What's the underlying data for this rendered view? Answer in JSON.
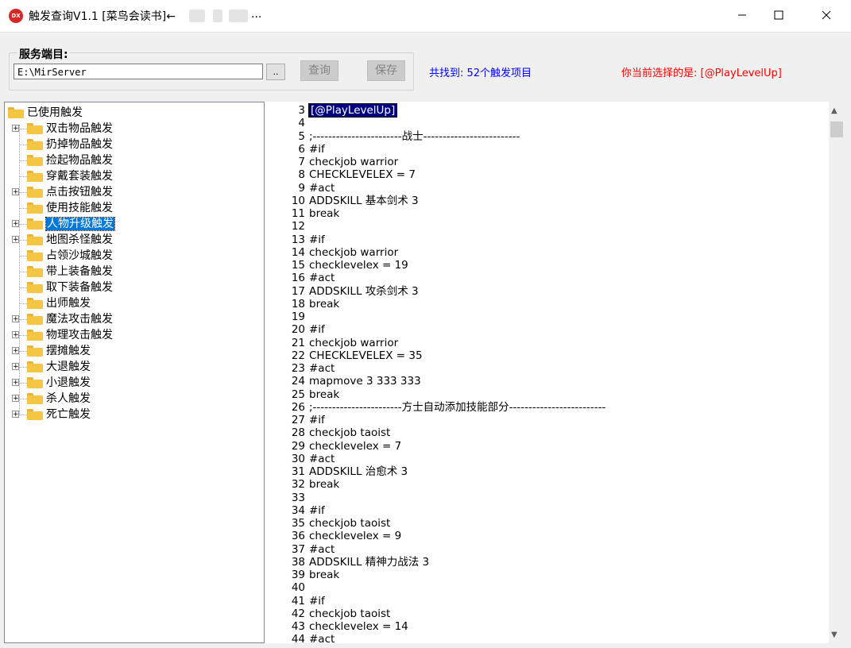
{
  "window": {
    "app_icon_text": "DX",
    "title": "触发查询V1.1 [菜鸟会读书]←",
    "title_trailing": "..."
  },
  "server": {
    "group_label": "服务端目:",
    "path_value": "E:\\MirServer",
    "browse_label": "..",
    "query_label": "查询",
    "save_label": "保存"
  },
  "status": {
    "found_text": "共找到: 52个触发项目",
    "selected_text": "你当前选择的是: [@PlayLevelUp]",
    "found_color": "#0000ff",
    "selected_color": "#ff0000"
  },
  "tree": {
    "root": "已使用触发",
    "items": [
      {
        "label": "双击物品触发",
        "expandable": true
      },
      {
        "label": "扔掉物品触发",
        "expandable": false
      },
      {
        "label": "捡起物品触发",
        "expandable": false
      },
      {
        "label": "穿戴套装触发",
        "expandable": false
      },
      {
        "label": "点击按钮触发",
        "expandable": true
      },
      {
        "label": "使用技能触发",
        "expandable": false
      },
      {
        "label": "人物升级触发",
        "expandable": true,
        "selected": true
      },
      {
        "label": "地图杀怪触发",
        "expandable": true
      },
      {
        "label": "占领沙城触发",
        "expandable": false
      },
      {
        "label": "带上装备触发",
        "expandable": false
      },
      {
        "label": "取下装备触发",
        "expandable": false
      },
      {
        "label": "出师触发",
        "expandable": false
      },
      {
        "label": "魔法攻击触发",
        "expandable": true
      },
      {
        "label": "物理攻击触发",
        "expandable": true
      },
      {
        "label": "摆摊触发",
        "expandable": true
      },
      {
        "label": "大退触发",
        "expandable": true
      },
      {
        "label": "小退触发",
        "expandable": true
      },
      {
        "label": "杀人触发",
        "expandable": true
      },
      {
        "label": "死亡触发",
        "expandable": true
      }
    ]
  },
  "editor": {
    "lines": [
      {
        "n": "3",
        "text": "[@PlayLevelUp]",
        "highlight": true
      },
      {
        "n": "4",
        "text": ""
      },
      {
        "n": "5",
        "text": ";-----------------------战士-------------------------"
      },
      {
        "n": "6",
        "text": "#if"
      },
      {
        "n": "7",
        "text": "checkjob warrior"
      },
      {
        "n": "8",
        "text": "CHECKLEVELEX = 7"
      },
      {
        "n": "9",
        "text": "#act"
      },
      {
        "n": "10",
        "text": "ADDSKILL 基本剑术 3"
      },
      {
        "n": "11",
        "text": "break"
      },
      {
        "n": "12",
        "text": ""
      },
      {
        "n": "13",
        "text": "#if"
      },
      {
        "n": "14",
        "text": "checkjob warrior"
      },
      {
        "n": "15",
        "text": "checklevelex = 19"
      },
      {
        "n": "16",
        "text": "#act"
      },
      {
        "n": "17",
        "text": "ADDSKILL 攻杀剑术 3"
      },
      {
        "n": "18",
        "text": "break"
      },
      {
        "n": "19",
        "text": ""
      },
      {
        "n": "20",
        "text": "#if"
      },
      {
        "n": "21",
        "text": "checkjob warrior"
      },
      {
        "n": "22",
        "text": "CHECKLEVELEX = 35"
      },
      {
        "n": "23",
        "text": "#act"
      },
      {
        "n": "24",
        "text": "mapmove  3  333  333"
      },
      {
        "n": "25",
        "text": "break"
      },
      {
        "n": "26",
        "text": ";-----------------------方士自动添加技能部分-------------------------"
      },
      {
        "n": "27",
        "text": "#if"
      },
      {
        "n": "28",
        "text": "checkjob taoist"
      },
      {
        "n": "29",
        "text": "checklevelex = 7"
      },
      {
        "n": "30",
        "text": "#act"
      },
      {
        "n": "31",
        "text": "ADDSKILL 治愈术 3"
      },
      {
        "n": "32",
        "text": "break"
      },
      {
        "n": "33",
        "text": ""
      },
      {
        "n": "34",
        "text": "#if"
      },
      {
        "n": "35",
        "text": "checkjob taoist"
      },
      {
        "n": "36",
        "text": "checklevelex = 9"
      },
      {
        "n": "37",
        "text": "#act"
      },
      {
        "n": "38",
        "text": "ADDSKILL 精神力战法 3"
      },
      {
        "n": "39",
        "text": "break"
      },
      {
        "n": "40",
        "text": ""
      },
      {
        "n": "41",
        "text": "#if"
      },
      {
        "n": "42",
        "text": "checkjob taoist"
      },
      {
        "n": "43",
        "text": "checklevelex = 14"
      },
      {
        "n": "44",
        "text": "#act"
      }
    ]
  }
}
